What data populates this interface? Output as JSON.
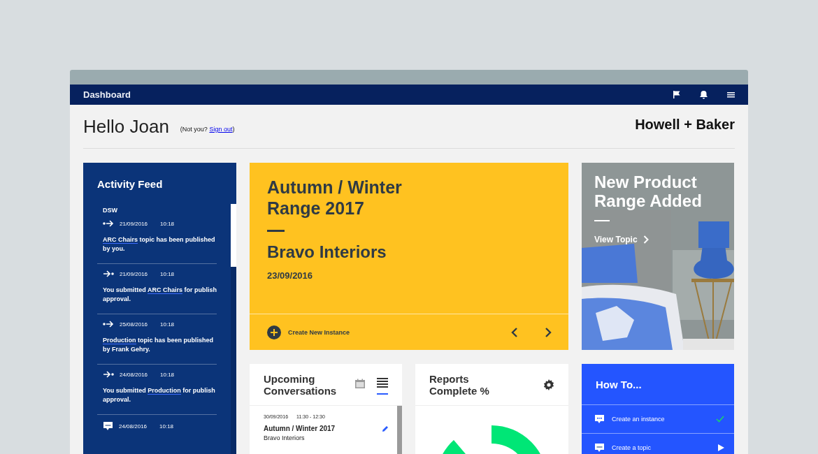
{
  "nav": {
    "title": "Dashboard",
    "icons": [
      {
        "kind": "flag"
      },
      {
        "kind": "bell"
      },
      {
        "kind": "menu"
      }
    ]
  },
  "header": {
    "greeting": "Hello Joan",
    "not_you": "(Not you?",
    "sign_out": "Sign out",
    "close_paren": ")",
    "brand": "Howell + Baker"
  },
  "activity_feed": {
    "title": "Activity Feed",
    "cut_text": "DSW",
    "items": [
      {
        "kind": "out",
        "date": "21/09/2016",
        "time": "10:18",
        "link": "ARC Chairs",
        "after": " topic has been published by you."
      },
      {
        "kind": "in",
        "date": "21/09/2016",
        "time": "10:18",
        "before": "You submitted ",
        "link": "ARC Chairs",
        "after": " for publish approval."
      },
      {
        "kind": "out",
        "date": "25/08/2016",
        "time": "10:18",
        "link": "Production",
        "after": " topic has been published by Frank Gehry."
      },
      {
        "kind": "in",
        "date": "24/08/2016",
        "time": "10:18",
        "before": "You submitted ",
        "link": "Production",
        "after": " for publish approval."
      },
      {
        "kind": "chat",
        "date": "24/08/2016",
        "time": "10:18"
      }
    ]
  },
  "feature": {
    "title_lines": [
      "Autumn / Winter",
      "Range 2017"
    ],
    "client": "Bravo Interiors",
    "date": "23/09/2016",
    "action": "Create New Instance"
  },
  "promo": {
    "kind": "picture",
    "title_lines": [
      "New Product",
      "Range Added"
    ],
    "link": "View Topic"
  },
  "conversations": {
    "title_lines": [
      "Upcoming",
      "Conversations"
    ],
    "views": [
      {
        "kind": "calendar",
        "selected": false
      },
      {
        "kind": "list",
        "selected": true
      }
    ],
    "items": [
      {
        "date": "30/09/2016",
        "time": "11:30 - 12:30",
        "title": "Autumn / Winter 2017",
        "subtitle": "Bravo Interiors"
      }
    ]
  },
  "reports": {
    "title_lines": [
      "Reports",
      "Complete %"
    ]
  },
  "how_to": {
    "title": "How To...",
    "items": [
      {
        "label": "Create an instance",
        "done": true
      },
      {
        "label": "Create a topic",
        "done": false
      }
    ]
  }
}
